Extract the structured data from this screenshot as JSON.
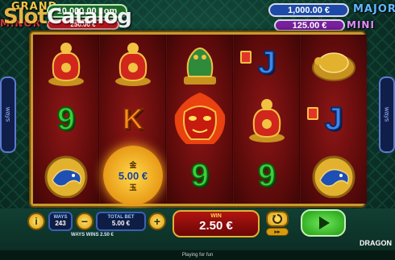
{
  "brand": {
    "logo_prefix": "Slot",
    "logo_suffix": "Catalog"
  },
  "jackpots": {
    "grand": {
      "label": "GRAND",
      "value": "10,000.00 com"
    },
    "minor": {
      "label": "MINOR",
      "value": "250.00 €"
    },
    "major": {
      "label": "MAJOR",
      "value": "1,000.00    €"
    },
    "mini": {
      "label": "MINI",
      "value": "125.00    €"
    }
  },
  "reels": {
    "coin_value": "5.00 €",
    "coin_glyph_top": "金",
    "coin_glyph_bottom": "玉",
    "symbols": {
      "nine": "9",
      "king": "K",
      "jack": "J"
    }
  },
  "side_tabs": {
    "left": "ways",
    "right": "ways"
  },
  "controls": {
    "info_icon": "i",
    "ways_label": "WAYS",
    "ways_value": "243",
    "minus": "−",
    "plus": "+",
    "total_bet_label": "TOTAL BET",
    "total_bet_value": "5.00  €",
    "ways_wins_label": "WAYS   WINS   2.50  €",
    "win_label": "WIN",
    "win_value": "2.50 €",
    "brand_right": "DRAGON"
  },
  "footer": {
    "text": "Playing for fun"
  },
  "colors": {
    "reel_bg": "#8e1616",
    "frame_gold": "#c89a2c",
    "jp_blue": "#1d4aa8",
    "jp_purple": "#7a1f9e",
    "spin_green": "#2fc21d"
  }
}
